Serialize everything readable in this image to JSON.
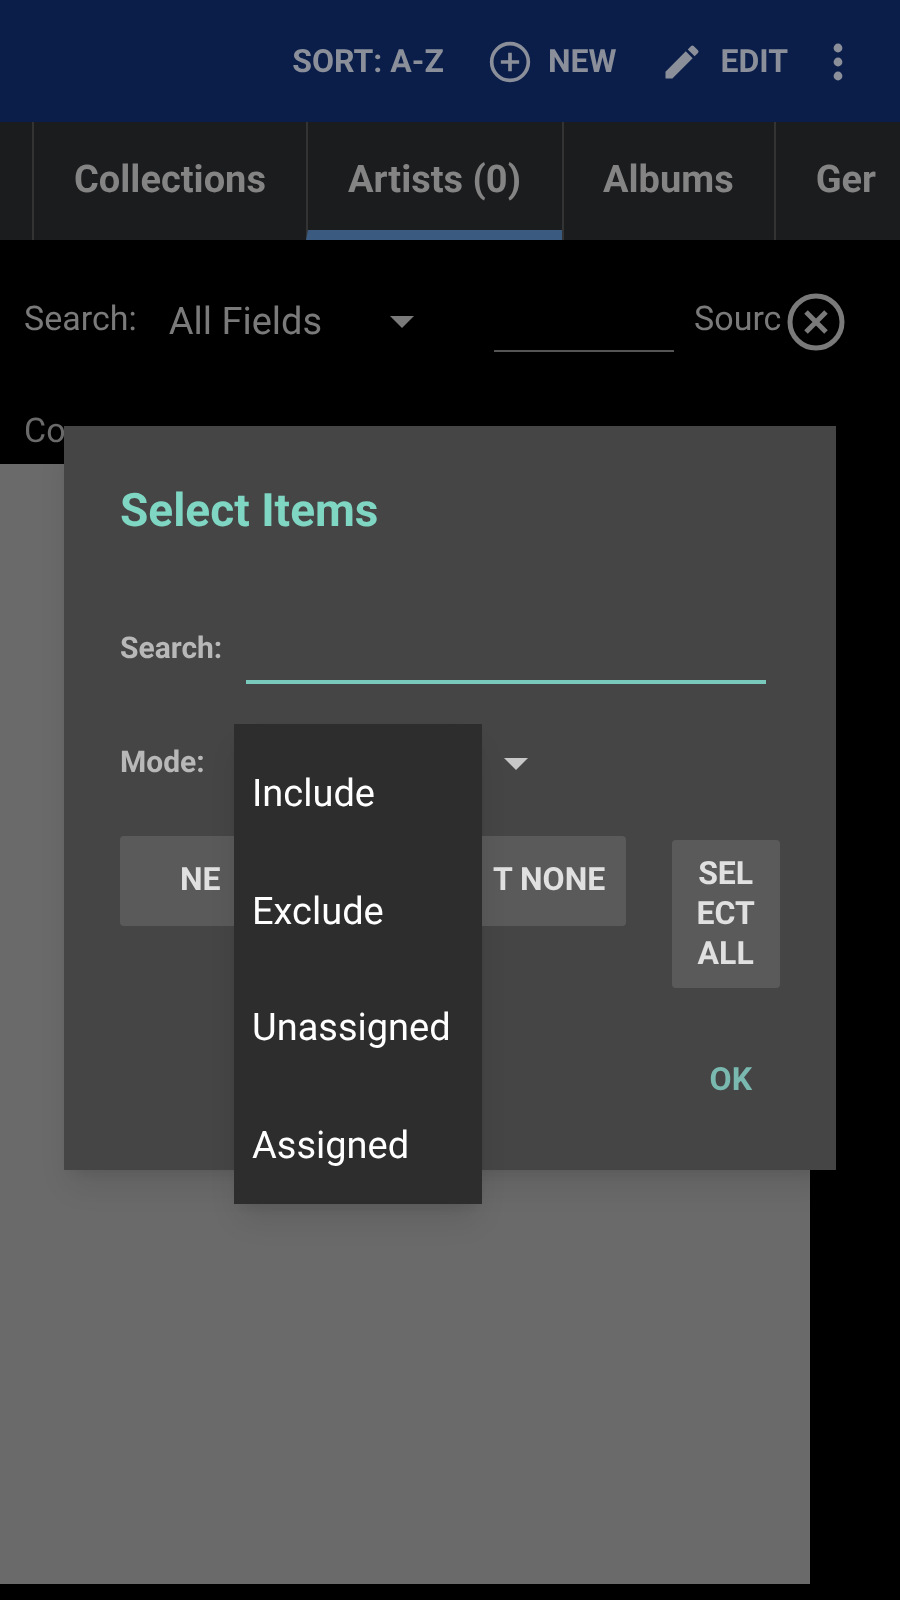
{
  "toolbar": {
    "actions": [
      {
        "kind": "text",
        "label": "SORT: A-Z"
      },
      {
        "kind": "plus",
        "label": "NEW"
      },
      {
        "kind": "pencil",
        "label": "EDIT"
      },
      {
        "kind": "more"
      }
    ]
  },
  "tabs": [
    {
      "label": "Collections",
      "selected": false
    },
    {
      "label": "Artists (0)",
      "selected": true
    },
    {
      "label": "Albums",
      "selected": false
    },
    {
      "label": "Ger",
      "selected": false
    }
  ],
  "filter": {
    "search_label": "Search:",
    "field_choice": "All Fields",
    "source_label": "Sourc",
    "row2_label": "Co"
  },
  "dialog": {
    "title": "Select Items",
    "search_label": "Search:",
    "mode_label": "Mode:",
    "buttons": [
      "NE",
      "T NONE"
    ],
    "select_all": "SEL ECT ALL",
    "ok": "OK"
  },
  "menu": {
    "items": [
      {
        "label": "Include"
      },
      {
        "label": "Exclude"
      },
      {
        "label": "Unassigned"
      },
      {
        "label": "Assigned"
      }
    ]
  }
}
